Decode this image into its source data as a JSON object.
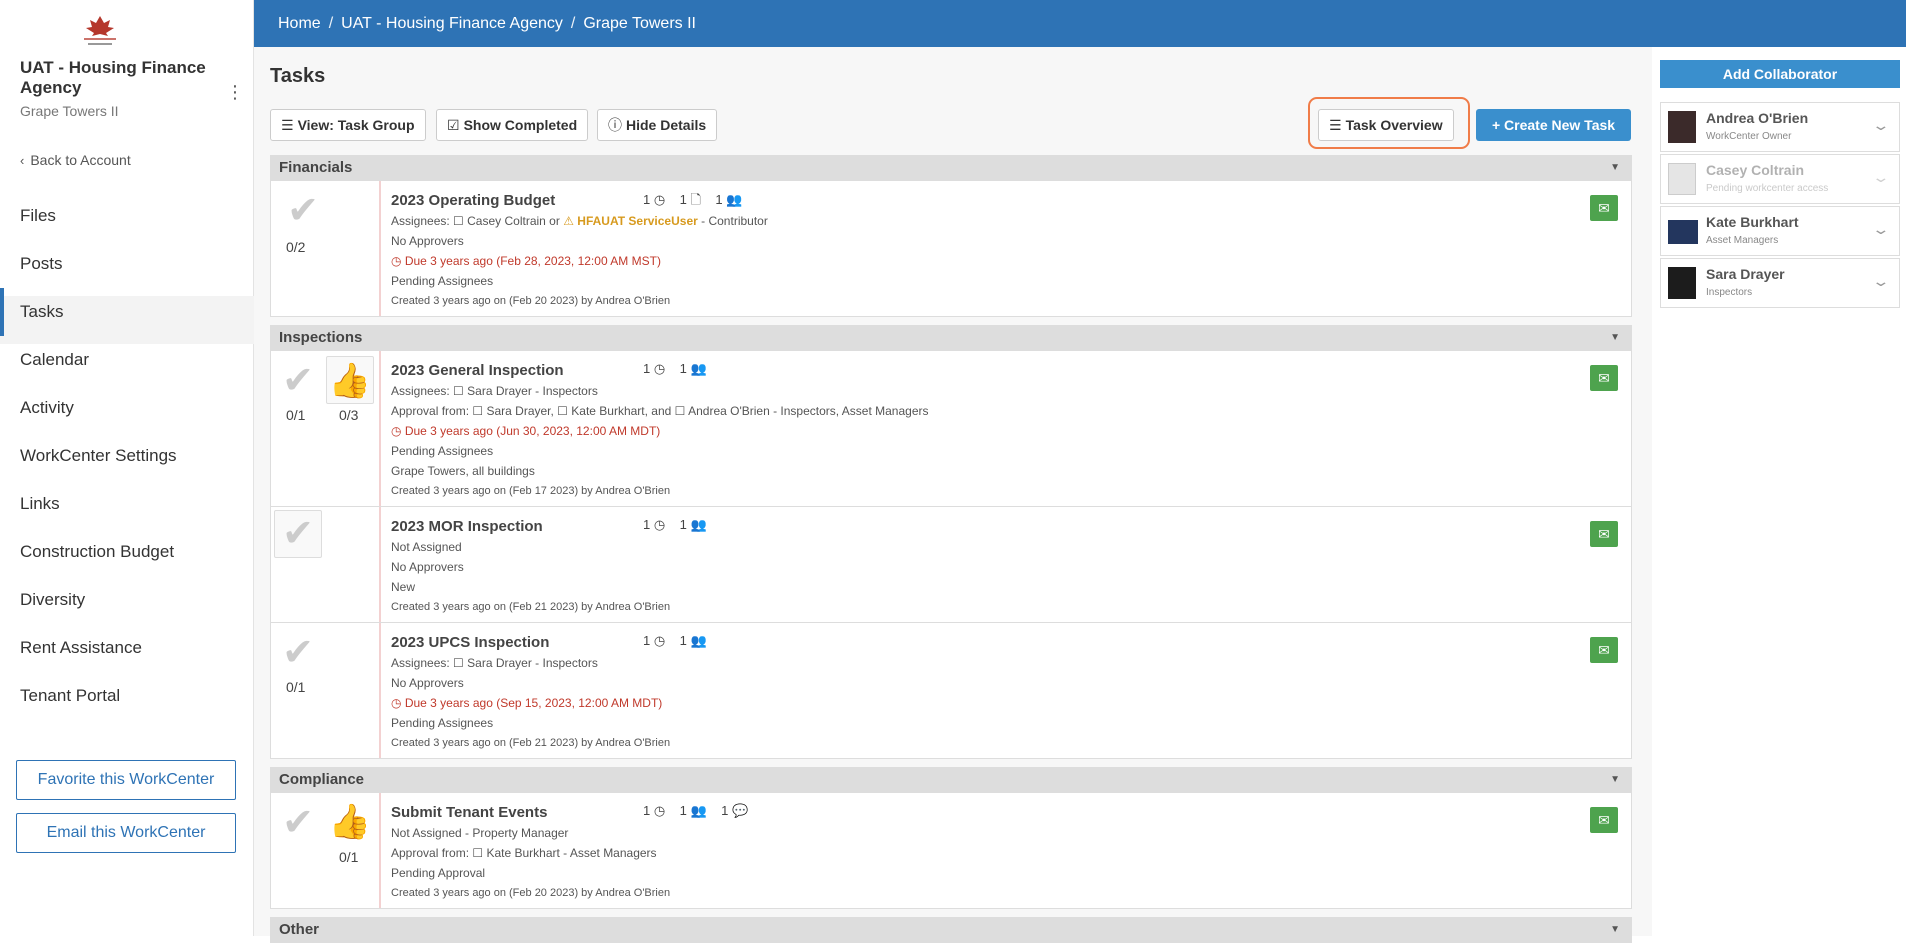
{
  "sidebar": {
    "org_name": "UAT - Housing Finance Agency",
    "org_sub": "Grape Towers II",
    "back_label": "Back to Account",
    "nav": [
      "Files",
      "Posts",
      "Tasks",
      "Calendar",
      "Activity",
      "WorkCenter Settings",
      "Links",
      "Construction Budget",
      "Diversity",
      "Rent Assistance",
      "Tenant Portal"
    ],
    "active_nav": "Tasks",
    "favorite_label": "Favorite this WorkCenter",
    "email_label": "Email this WorkCenter",
    "logo_text": "HOUSING FINANCE AGENCY"
  },
  "breadcrumb": [
    "Home",
    "UAT - Housing Finance Agency",
    "Grape Towers II"
  ],
  "page": {
    "title": "Tasks",
    "toolbar": {
      "view_label": "View: Task Group",
      "completed_label": "Show Completed",
      "details_label": "Hide Details",
      "overview_label": "Task Overview",
      "create_label": "Create New Task"
    }
  },
  "groups": [
    {
      "name": "Financials"
    },
    {
      "name": "Inspections"
    },
    {
      "name": "Compliance"
    },
    {
      "name": "Other"
    }
  ],
  "tasks": {
    "t1": {
      "name": "2023 Operating Budget",
      "m1": "1",
      "m2": "1",
      "m3": "1",
      "count": "0/2",
      "assignees_prefix": "Assignees:",
      "assignees": "Casey Coltrain or",
      "assignees_warn": "HFAUAT ServiceUser",
      "assignees_suffix": "- Contributor",
      "approvers": "No Approvers",
      "due": "Due 3 years ago (Feb 28, 2023, 12:00 AM MST)",
      "status": "Pending Assignees",
      "created": "Created 3 years ago on (Feb 20 2023) by Andrea O'Brien"
    },
    "t2": {
      "name": "2023 General Inspection",
      "m1": "1",
      "m2": "1",
      "count": "0/1",
      "count2": "0/3",
      "assignees_prefix": "Assignees:",
      "assignees": "Sara Drayer - Inspectors",
      "approval_prefix": "Approval from:",
      "approval_a": "Sara Drayer,",
      "approval_b": "Kate Burkhart, and",
      "approval_c": "Andrea O'Brien - Inspectors, Asset Managers",
      "due": "Due 3 years ago (Jun 30, 2023, 12:00 AM MDT)",
      "status": "Pending Assignees",
      "location": "Grape Towers, all buildings",
      "created": "Created 3 years ago on (Feb 17 2023) by Andrea O'Brien"
    },
    "t3": {
      "name": "2023 MOR Inspection",
      "m1": "1",
      "m2": "1",
      "assignees": "Not Assigned",
      "approvers": "No Approvers",
      "status": "New",
      "created": "Created 3 years ago on (Feb 21 2023) by Andrea O'Brien"
    },
    "t4": {
      "name": "2023 UPCS Inspection",
      "m1": "1",
      "m2": "1",
      "count": "0/1",
      "assignees_prefix": "Assignees:",
      "assignees": "Sara Drayer - Inspectors",
      "approvers": "No Approvers",
      "due": "Due 3 years ago (Sep 15, 2023, 12:00 AM MDT)",
      "status": "Pending Assignees",
      "created": "Created 3 years ago on (Feb 21 2023) by Andrea O'Brien"
    },
    "t5": {
      "name": "Submit Tenant Events",
      "m1": "1",
      "m2": "1",
      "m3": "1",
      "count": "0/1",
      "assignees": "Not Assigned - Property Manager",
      "approval_prefix": "Approval from:",
      "approval_a": "Kate Burkhart - Asset Managers",
      "status": "Pending Approval",
      "created": "Created 3 years ago on (Feb 20 2023) by Andrea O'Brien"
    }
  },
  "collaborators": {
    "add_label": "Add Collaborator",
    "list": [
      {
        "name": "Andrea O'Brien",
        "role": "WorkCenter Owner"
      },
      {
        "name": "Casey Coltrain",
        "role": "Pending workcenter access"
      },
      {
        "name": "Kate Burkhart",
        "role": "Asset Managers"
      },
      {
        "name": "Sara Drayer",
        "role": "Inspectors"
      }
    ]
  },
  "colors": {
    "brand": "#2e73b5",
    "accent": "#3a8fcd",
    "highlight": "#f07c48",
    "mail": "#4ea34e",
    "due": "#c0392b"
  }
}
